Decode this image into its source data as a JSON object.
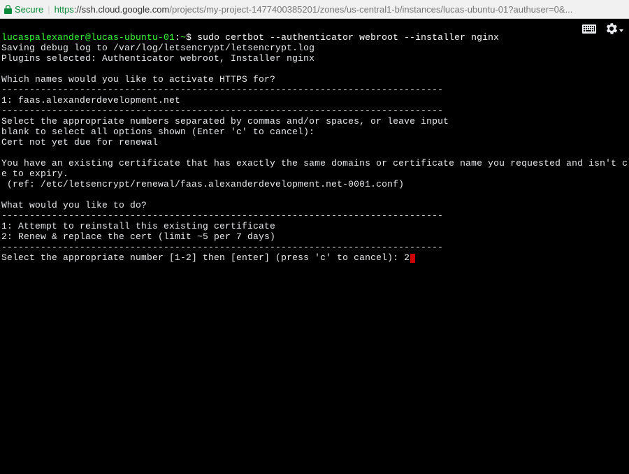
{
  "addressBar": {
    "secureLabel": "Secure",
    "scheme": "https",
    "host": "://ssh.cloud.google.com",
    "path": "/projects/my-project-1477400385201/zones/us-central1-b/instances/lucas-ubuntu-01?authuser=0&..."
  },
  "prompt": {
    "userHost": "lucaspalexander@lucas-ubuntu-01",
    "separator": ":",
    "cwd": "~",
    "symbol": "$ ",
    "command": "sudo certbot --authenticator webroot --installer nginx"
  },
  "lines": {
    "l1": "Saving debug log to /var/log/letsencrypt/letsencrypt.log",
    "l2": "Plugins selected: Authenticator webroot, Installer nginx",
    "l3": "",
    "l4": "Which names would you like to activate HTTPS for?",
    "l5": "-------------------------------------------------------------------------------",
    "l6": "1: faas.alexanderdevelopment.net",
    "l7": "-------------------------------------------------------------------------------",
    "l8": "Select the appropriate numbers separated by commas and/or spaces, or leave input",
    "l9": "blank to select all options shown (Enter 'c' to cancel):",
    "l10": "Cert not yet due for renewal",
    "l11": "",
    "l12": "You have an existing certificate that has exactly the same domains or certificate name you requested and isn't clos",
    "l13": "e to expiry.",
    "l14": " (ref: /etc/letsencrypt/renewal/faas.alexanderdevelopment.net-0001.conf)",
    "l15": "",
    "l16": "What would you like to do?",
    "l17": "-------------------------------------------------------------------------------",
    "l18": "1: Attempt to reinstall this existing certificate",
    "l19": "2: Renew & replace the cert (limit ~5 per 7 days)",
    "l20": "-------------------------------------------------------------------------------",
    "l21a": "Select the appropriate number [1-2] then [enter] (press 'c' to cancel): ",
    "l21b": "2"
  }
}
